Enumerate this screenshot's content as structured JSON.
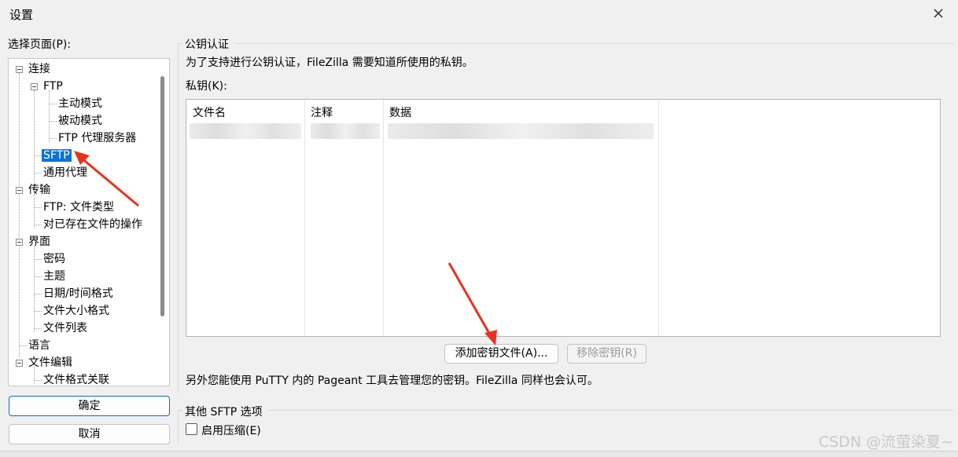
{
  "dialog": {
    "title": "设置",
    "close_icon": "close-icon"
  },
  "tree": {
    "label": "选择页面(P):",
    "items": [
      {
        "label": "连接",
        "expanded": true
      },
      {
        "label": "FTP",
        "expanded": true
      },
      {
        "label": "主动模式"
      },
      {
        "label": "被动模式"
      },
      {
        "label": "FTP 代理服务器"
      },
      {
        "label": "SFTP",
        "selected": true
      },
      {
        "label": "通用代理"
      },
      {
        "label": "传输",
        "expanded": true
      },
      {
        "label": "FTP: 文件类型"
      },
      {
        "label": "对已存在文件的操作"
      },
      {
        "label": "界面",
        "expanded": true
      },
      {
        "label": "密码"
      },
      {
        "label": "主题"
      },
      {
        "label": "日期/时间格式"
      },
      {
        "label": "文件大小格式"
      },
      {
        "label": "文件列表"
      },
      {
        "label": "语言"
      },
      {
        "label": "文件编辑",
        "expanded": true
      },
      {
        "label": "文件格式关联"
      }
    ]
  },
  "buttons": {
    "ok": "确定",
    "cancel": "取消",
    "add_key": "添加密钥文件(A)...",
    "remove_key": "移除密钥(R)"
  },
  "pubkey": {
    "group_title": "公钥认证",
    "description": "为了支持进行公钥认证，FileZilla 需要知道所使用的私钥。",
    "private_key_label": "私钥(K):",
    "columns": [
      "文件名",
      "注释",
      "数据"
    ],
    "pageant_note": "另外您能使用 PuTTY 内的 Pageant 工具去管理您的密钥。FileZilla 同样也会认可。"
  },
  "other": {
    "group_title": "其他 SFTP 选项",
    "compression_label": "启用压缩(E)",
    "compression_checked": false
  },
  "watermark": "CSDN @流萤染夏~",
  "colors": {
    "selection": "#0b73d8",
    "annotation_arrow": "#e8321e"
  }
}
